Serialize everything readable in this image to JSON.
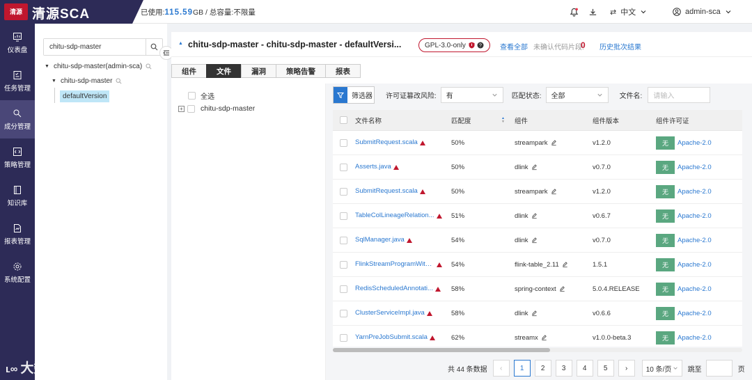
{
  "brand": {
    "logo_small": "清源",
    "name": "清源SCA"
  },
  "usage": {
    "used_label": "已使用:",
    "used_value": "115.59",
    "used_unit": "GB",
    "sep": " / ",
    "total_label": "总容量:",
    "total_value": "不限量"
  },
  "topbar": {
    "language": "中文",
    "user": "admin-sca"
  },
  "nav": [
    {
      "label": "仪表盘",
      "icon": "dashboard-icon"
    },
    {
      "label": "任务管理",
      "icon": "task-icon"
    },
    {
      "label": "成分管理",
      "icon": "component-icon"
    },
    {
      "label": "策略管理",
      "icon": "policy-icon"
    },
    {
      "label": "知识库",
      "icon": "knowledge-icon"
    },
    {
      "label": "报表管理",
      "icon": "report-icon"
    },
    {
      "label": "系统配置",
      "icon": "settings-icon"
    }
  ],
  "tree": {
    "search_value": "chitu-sdp-master",
    "root": "chitu-sdp-master(admin-sca)",
    "child": "chitu-sdp-master",
    "leaf": "defaultVersion"
  },
  "header": {
    "title": "chitu-sdp-master - chitu-sdp-master - defaultVersi...",
    "license": "GPL-3.0-only",
    "view_all": "查看全部",
    "unconfirmed_label": "未确认代码片段:",
    "unconfirmed_count": "0",
    "history": "历史批次结果"
  },
  "tabs": [
    "组件",
    "文件",
    "漏洞",
    "策略告警",
    "报表"
  ],
  "filetree": {
    "select_all": "全选",
    "root": "chitu-sdp-master"
  },
  "filters": {
    "button": "筛选器",
    "risk_label": "许可证篡改风险:",
    "risk_value": "有",
    "match_label": "匹配状态:",
    "match_value": "全部",
    "filename_label": "文件名:",
    "filename_placeholder": "请输入"
  },
  "table": {
    "headers": [
      "文件名称",
      "匹配度",
      "组件",
      "组件版本",
      "组件许可证"
    ],
    "rows": [
      {
        "file": "SubmitRequest.scala",
        "match": "50%",
        "component": "streampark",
        "version": "v1.2.0",
        "badge": "无",
        "license": "Apache-2.0"
      },
      {
        "file": "Asserts.java",
        "match": "50%",
        "component": "dlink",
        "version": "v0.7.0",
        "badge": "无",
        "license": "Apache-2.0"
      },
      {
        "file": "SubmitRequest.scala",
        "match": "50%",
        "component": "streampark",
        "version": "v1.2.0",
        "badge": "无",
        "license": "Apache-2.0"
      },
      {
        "file": "TableColLineageRelation...",
        "match": "51%",
        "component": "dlink",
        "version": "v0.6.7",
        "badge": "无",
        "license": "Apache-2.0"
      },
      {
        "file": "SqlManager.java",
        "match": "54%",
        "component": "dlink",
        "version": "v0.7.0",
        "badge": "无",
        "license": "Apache-2.0"
      },
      {
        "file": "FlinkStreamProgramWith...",
        "match": "54%",
        "component": "flink-table_2.11",
        "version": "1.5.1",
        "badge": "无",
        "license": "Apache-2.0"
      },
      {
        "file": "RedisScheduledAnnotati...",
        "match": "58%",
        "component": "spring-context",
        "version": "5.0.4.RELEASE",
        "badge": "无",
        "license": "Apache-2.0"
      },
      {
        "file": "ClusterServiceImpl.java",
        "match": "58%",
        "component": "dlink",
        "version": "v0.6.6",
        "badge": "无",
        "license": "Apache-2.0"
      },
      {
        "file": "YarnPreJobSubmit.scala",
        "match": "62%",
        "component": "streamx",
        "version": "v1.0.0-beta.3",
        "badge": "无",
        "license": "Apache-2.0"
      }
    ]
  },
  "pagination": {
    "total": "共 44 条数据",
    "pages": [
      "1",
      "2",
      "3",
      "4",
      "5"
    ],
    "page_size": "10 条/页",
    "goto": "跳至",
    "unit": "页"
  },
  "watermark": "大数跨境",
  "colors": {
    "sidebar": "#2d2b57",
    "brand_red": "#c0172e",
    "link": "#2a78d0",
    "badge_green": "#5aa780"
  }
}
